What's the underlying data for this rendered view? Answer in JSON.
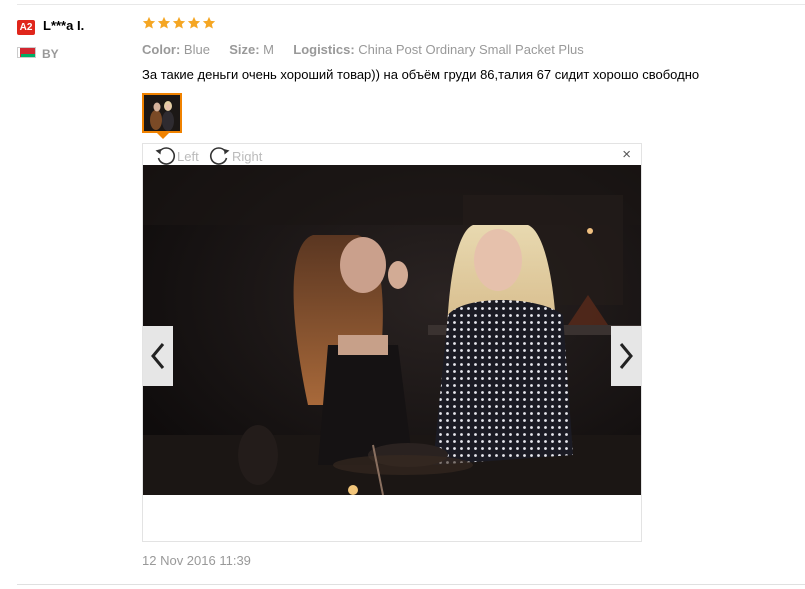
{
  "review": {
    "level_badge": "A2",
    "user_name": "L***a I.",
    "country": "BY",
    "rating": 5,
    "attributes": {
      "color_label": "Color:",
      "color_value": "Blue",
      "size_label": "Size:",
      "size_value": "M",
      "logistics_label": "Logistics:",
      "logistics_value": "China Post Ordinary Small Packet Plus"
    },
    "text": "За такие деньги очень хороший товар)) на объём груди 86,талия 67 сидит хорошо свободно",
    "date": "12 Nov 2016 11:39"
  },
  "viewer": {
    "rotate_left_label": "Left",
    "rotate_right_label": "Right",
    "close_glyph": "×"
  },
  "icons": {
    "star": "star-icon",
    "rotate_left": "rotate-left-icon",
    "rotate_right": "rotate-right-icon",
    "prev": "chevron-left-icon",
    "next": "chevron-right-icon",
    "close": "close-icon"
  },
  "colors": {
    "badge": "#e0261b",
    "star": "#f5a623",
    "thumb_border": "#f08200"
  }
}
